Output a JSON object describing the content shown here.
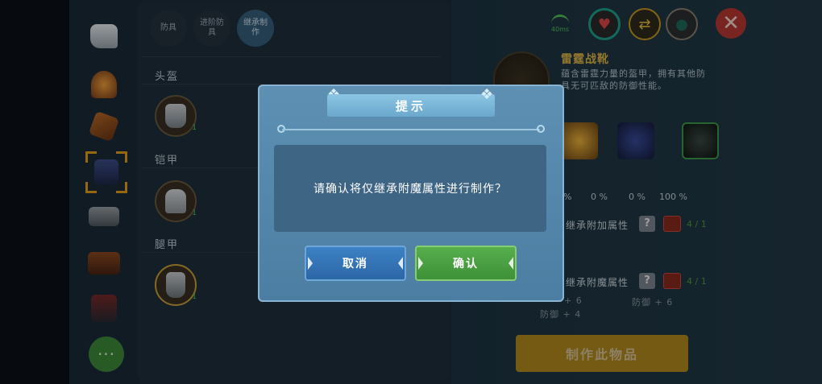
{
  "tabs": [
    {
      "label": "防具",
      "active": false
    },
    {
      "label": "进阶防具",
      "active": false
    },
    {
      "label": "继承制作",
      "active": true
    }
  ],
  "sections": [
    {
      "title": "头盔",
      "item": {
        "name": "helmet",
        "count": "1"
      }
    },
    {
      "title": "铠甲",
      "item": {
        "name": "armor",
        "count": "1"
      }
    },
    {
      "title": "腿甲",
      "item": {
        "name": "leggings",
        "count": "1"
      }
    }
  ],
  "rail_icons": [
    "glove-icon",
    "campfire-icon",
    "crossbow-icon",
    "block-icon",
    "anvil-icon",
    "chest-icon",
    "backpack-icon",
    "more-icon"
  ],
  "detail": {
    "title": "雷霆战靴",
    "description": "蕴含雷霆力量的盔甲，拥有其他防具无可匹敌的防御性能。",
    "percents": [
      "%",
      "0 %",
      "0 %",
      "100 %"
    ],
    "inherit_add_label": "继承附加属性",
    "inherit_add_count": "4 / 1",
    "inherit_enchant_label": "继承附魔属性",
    "inherit_enchant_count": "4 / 1",
    "stats": [
      "+ 6",
      "防御 + 6",
      "防御 + 4"
    ],
    "question_mark": "?",
    "make_button": "制作此物品"
  },
  "hud": {
    "signal_text": "40ms",
    "heart": "♥",
    "swap": "⇄",
    "drop": "●",
    "close": "✕"
  },
  "dialog": {
    "title": "提示",
    "message": "请确认将仅继承附魔属性进行制作？",
    "cancel": "取消",
    "confirm": "确认"
  },
  "more_button": "···",
  "colors": {
    "accent_gold": "#e6a21a",
    "dialog_blue": "#5e90b3",
    "confirm_green": "#58b04e",
    "cancel_blue": "#3d83c5",
    "close_red": "#b83a34"
  }
}
